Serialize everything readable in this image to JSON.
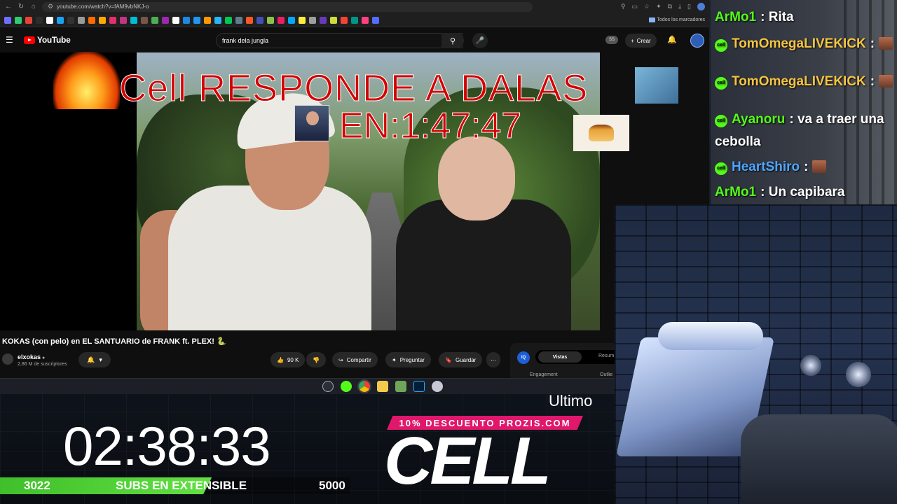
{
  "browser": {
    "url": "youtube.com/watch?v=fAM9vbNKJ-o",
    "bookmarks_folder": "Todos los marcadores",
    "bookmark_colors": [
      "#6f6fff",
      "#2ecc71",
      "#ea4335",
      "#2c2c2c",
      "#ffffff",
      "#1da1f2",
      "#333333",
      "#999999",
      "#ff6b00",
      "#ffaa00",
      "#e1306c",
      "#c13584",
      "#00bcd4",
      "#795548",
      "#4caf50",
      "#9c27b0",
      "#ffffff",
      "#1e88e5",
      "#2196f3",
      "#ff9800",
      "#29b6f6",
      "#00c853",
      "#607d8b",
      "#ff5722",
      "#3f51b5",
      "#8bc34a",
      "#e91e63",
      "#03a9f4",
      "#ffeb3b",
      "#9e9e9e",
      "#673ab7",
      "#cddc39",
      "#f44336",
      "#009688",
      "#ff4081",
      "#536dfe"
    ]
  },
  "youtube": {
    "logo_text": "YouTube",
    "search_value": "frank dela jungla",
    "ss_badge": "SS",
    "create_label": "Crear",
    "video_title": "KOKAS (con pelo) en EL SANTUARIO de FRANK ft. PLEX! 🐍",
    "channel_name": "elxokas",
    "channel_subs": "2,86 M de suscriptores",
    "likes": "90 K",
    "share_label": "Compartir",
    "ask_label": "Preguntar",
    "save_label": "Guardar",
    "panel": {
      "iq_label": "IQ",
      "tab_active": "Vistas",
      "tab_other": "Resum",
      "engagement": "Engagement",
      "outlier": "Outlie"
    }
  },
  "overlay": {
    "title": "Cell RESPONDE A DALAS",
    "en_prefix": "EN:",
    "countdown": "1:47:47"
  },
  "chat": [
    {
      "user": "ArMo1",
      "user_color": "#53fc18",
      "badge": false,
      "text": ": Rita",
      "emote": false
    },
    {
      "user": "TomOmegaLIVEKICK",
      "user_color": "#f5c542",
      "badge": true,
      "text": ":",
      "emote": true
    },
    {
      "user": "TomOmegaLIVEKICK",
      "user_color": "#f5c542",
      "badge": true,
      "text": ":",
      "emote": true
    },
    {
      "user": "Ayanoru",
      "user_color": "#53fc18",
      "badge": true,
      "text": ": va a traer una",
      "emote": false
    },
    {
      "user": "",
      "user_color": "#ffffff",
      "badge": false,
      "text": "cebolla",
      "emote": false
    },
    {
      "user": "HeartShiro",
      "user_color": "#4ea6ff",
      "badge": true,
      "text": ":",
      "emote": true
    },
    {
      "user": "ArMo1",
      "user_color": "#53fc18",
      "badge": false,
      "text": ": Un capibara",
      "emote": false
    }
  ],
  "stream": {
    "ticker": "Ultimo",
    "timer": "02:38:33",
    "subs_current": "3022",
    "subs_label": "SUBS EN EXTENSIBLE",
    "subs_goal": "5000",
    "subs_progress": 0.6044,
    "promo": "10% DESCUENTO PROZIS.COM",
    "brand": "CELL"
  },
  "icons": {
    "back": "←",
    "forward": "→",
    "reload": "↻",
    "home": "⌂",
    "menu": "☰",
    "search": "⚲",
    "clear": "✕",
    "mic": "🎤",
    "bell": "🔔",
    "plus": "+",
    "like": "👍",
    "dislike": "👎",
    "share": "↪",
    "sparkle": "✦",
    "save": "🔖",
    "more": "⋯",
    "chevron_down": "▾",
    "verified": "●"
  }
}
